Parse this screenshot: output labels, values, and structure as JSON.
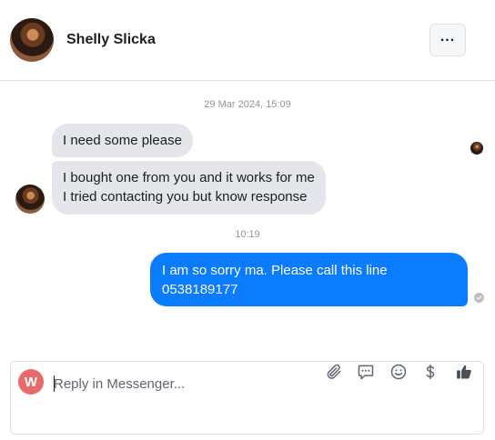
{
  "header": {
    "contact_name": "Shelly Slicka",
    "more_label": "..."
  },
  "conversation": {
    "timestamp_1": "29 Mar 2024, 15:09",
    "incoming": [
      {
        "lines": [
          "I need some please"
        ]
      },
      {
        "lines": [
          "I bought one from you and it works for me",
          "I tried contacting you but know response"
        ]
      }
    ],
    "timestamp_2": "10:19",
    "outgoing": [
      {
        "lines": [
          "I am so sorry ma. Please call this line",
          "0538189177"
        ]
      }
    ]
  },
  "composer": {
    "avatar_letter": "W",
    "placeholder": "Reply in Messenger...",
    "tools": [
      "paperclip-icon",
      "saved-replies-icon",
      "emoji-icon",
      "dollar-icon",
      "thumbs-up-icon"
    ]
  },
  "colors": {
    "outgoing_bubble": "#0a7cff",
    "incoming_bubble": "#e4e6eb",
    "user_avatar": "#e86a6a",
    "icon_gray": "#606770"
  }
}
